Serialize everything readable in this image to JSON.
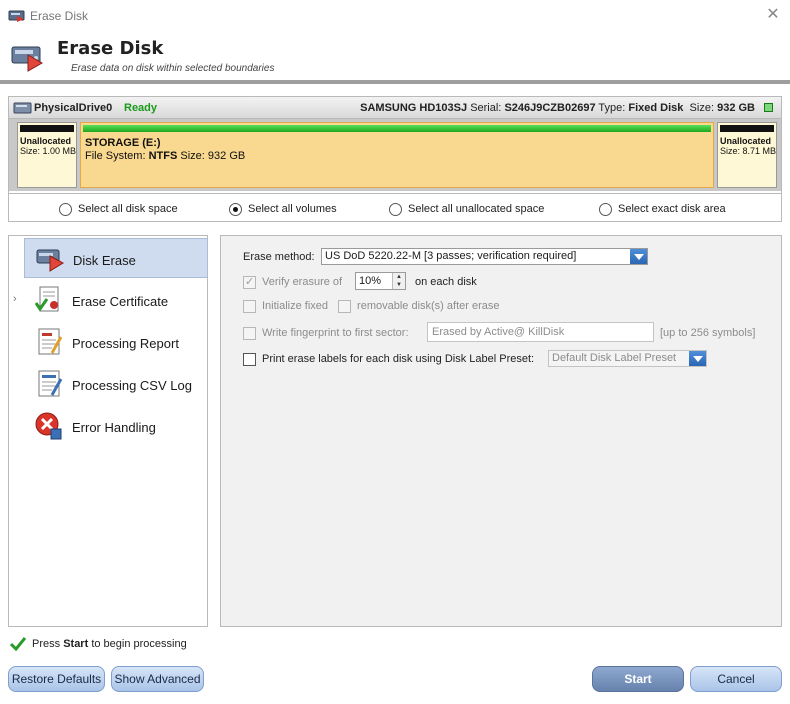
{
  "window": {
    "title": "Erase Disk",
    "close_icon": "close-icon"
  },
  "header": {
    "title": "Erase Disk",
    "subtitle": "Erase data on disk within selected boundaries"
  },
  "disk": {
    "name": "PhysicalDrive0",
    "status": "Ready",
    "model": "SAMSUNG HD103SJ",
    "serial_label": "Serial:",
    "serial": "S246J9CZB02697",
    "type_label": "Type:",
    "type": "Fixed Disk",
    "size_label": "Size:",
    "size": "932 GB",
    "partitions": [
      {
        "title": "Unallocated",
        "size_label": "Size:",
        "size": "1.00 MB"
      },
      {
        "title": "STORAGE (E:)",
        "fs_label": "File System:",
        "fs": "NTFS",
        "size_label": "Size:",
        "size": "932 GB"
      },
      {
        "title": "Unallocated",
        "size_label": "Size:",
        "size": "8.71 MB"
      }
    ],
    "selection_options": [
      "Select all disk space",
      "Select all volumes",
      "Select all unallocated space",
      "Select exact disk area"
    ],
    "selected_option": "Select all volumes"
  },
  "nav": {
    "items": [
      {
        "label": "Disk Erase",
        "icon": "disk-erase-icon",
        "active": true
      },
      {
        "label": "Erase Certificate",
        "icon": "certificate-icon",
        "active": false
      },
      {
        "label": "Processing Report",
        "icon": "report-icon",
        "active": false
      },
      {
        "label": "Processing CSV Log",
        "icon": "csv-log-icon",
        "active": false
      },
      {
        "label": "Error Handling",
        "icon": "error-icon",
        "active": false
      }
    ]
  },
  "settings": {
    "erase_method_label": "Erase method:",
    "erase_method_value": "US DoD 5220.22-M [3 passes; verification required]",
    "verify_label": "Verify erasure of",
    "verify_value": "10%",
    "verify_suffix": "on each disk",
    "initialize_label": "Initialize fixed",
    "removable_label": "removable disk(s) after erase",
    "fingerprint_label": "Write fingerprint to first sector:",
    "fingerprint_value": "Erased by Active@ KillDisk",
    "fingerprint_hint": "[up to 256 symbols]",
    "print_labels_label": "Print erase labels for each disk using Disk Label Preset:",
    "preset_value": "Default Disk Label Preset"
  },
  "footer": {
    "hint_prefix": "Press",
    "hint_bold": "Start",
    "hint_suffix": "to begin processing",
    "restore_label": "Restore Defaults",
    "advanced_label": "Show Advanced",
    "start_label": "Start",
    "cancel_label": "Cancel"
  },
  "colors": {
    "ready_green": "#1a9a1a",
    "partition_fill": "#f9d88f",
    "accent_blue": "#2a66b3"
  }
}
